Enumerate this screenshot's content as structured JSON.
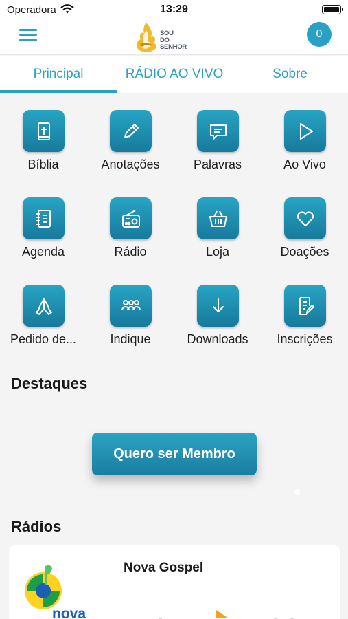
{
  "status_bar": {
    "carrier": "Operadora",
    "time": "13:29"
  },
  "header": {
    "logo_lines": [
      "SOU",
      "DO",
      "SENHOR"
    ],
    "cart_count": "0"
  },
  "tabs": [
    {
      "label": "Principal",
      "active": true
    },
    {
      "label": "RÁDIO AO VIVO",
      "active": false
    },
    {
      "label": "Sobre",
      "active": false
    }
  ],
  "grid": [
    {
      "label": "Bíblia",
      "icon": "bible-icon"
    },
    {
      "label": "Anotações",
      "icon": "pencil-icon"
    },
    {
      "label": "Palavras",
      "icon": "chat-icon"
    },
    {
      "label": "Ao Vivo",
      "icon": "play-icon"
    },
    {
      "label": "Agenda",
      "icon": "notebook-icon"
    },
    {
      "label": "Rádio",
      "icon": "radio-icon"
    },
    {
      "label": "Loja",
      "icon": "basket-icon"
    },
    {
      "label": "Doações",
      "icon": "heart-icon"
    },
    {
      "label": "Pedido de...",
      "icon": "praying-hands-icon"
    },
    {
      "label": "Indique",
      "icon": "people-icon"
    },
    {
      "label": "Downloads",
      "icon": "download-icon"
    },
    {
      "label": "Inscrições",
      "icon": "form-icon"
    }
  ],
  "featured": {
    "title": "Destaques",
    "button_label": "Quero ser Membro"
  },
  "radios": {
    "title": "Rádios",
    "items": [
      {
        "name": "Nova Gospel",
        "logo_text": "nova"
      }
    ]
  },
  "colors": {
    "accent": "#2aa0c4",
    "tile_top": "#28a4c3",
    "tile_bottom": "#177a9c",
    "background": "#f4f4f5"
  }
}
